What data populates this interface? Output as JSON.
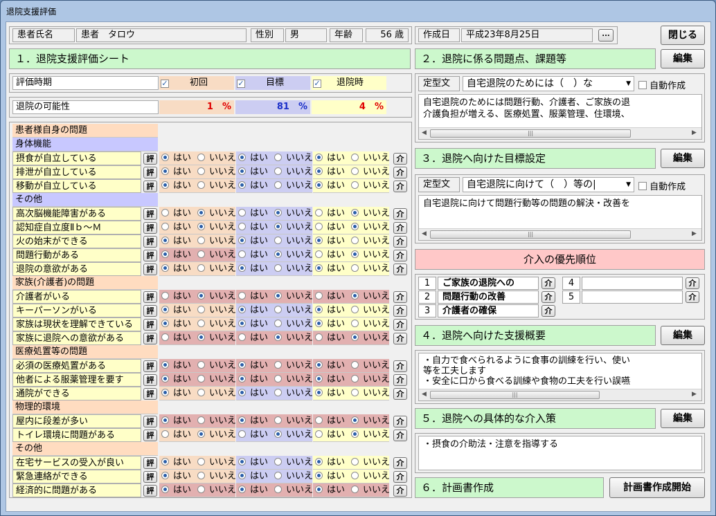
{
  "window": {
    "title": "退院支援評価"
  },
  "patient": {
    "name_label": "患者氏名",
    "name": "患者　タロウ",
    "sex_label": "性別",
    "sex": "男",
    "age_label": "年齢",
    "age": "56 歳"
  },
  "header": {
    "date_label": "作成日",
    "date": "平成23年8月25日",
    "dots_label": "...",
    "close_label": "閉じる"
  },
  "sheet": {
    "title": "１．退院支援評価シート",
    "eval_label": "評価時期",
    "col1": "初回",
    "col2": "目標",
    "col3": "退院時",
    "possibility_label": "退院の可能性",
    "p1": "1",
    "p2": "81",
    "p3": "4",
    "pct": "%"
  },
  "labels": {
    "yes": "はい",
    "no": "いいえ",
    "eval_btn": "評",
    "int_btn": "介"
  },
  "items": [
    {
      "type": "header",
      "style": "hdrO",
      "label": "患者様自身の問題"
    },
    {
      "type": "header",
      "style": "hdrB",
      "label": "身体機能"
    },
    {
      "type": "item",
      "label": "摂食が自立している",
      "vals": [
        1,
        1,
        1
      ],
      "reds": [
        0,
        0,
        0
      ]
    },
    {
      "type": "item",
      "label": "排泄が自立している",
      "vals": [
        1,
        1,
        1
      ],
      "reds": [
        0,
        0,
        0
      ]
    },
    {
      "type": "item",
      "label": "移動が自立している",
      "vals": [
        1,
        1,
        1
      ],
      "reds": [
        0,
        0,
        0
      ]
    },
    {
      "type": "header",
      "style": "hdrB",
      "label": "その他"
    },
    {
      "type": "item",
      "label": "高次脳機能障害がある",
      "vals": [
        0,
        0,
        0
      ],
      "reds": [
        0,
        0,
        0
      ]
    },
    {
      "type": "item",
      "label": "認知症自立度Ⅱｂ～Ｍ",
      "vals": [
        0,
        0,
        0
      ],
      "reds": [
        0,
        0,
        0
      ]
    },
    {
      "type": "item",
      "label": "火の始末ができる",
      "vals": [
        1,
        1,
        1
      ],
      "reds": [
        0,
        0,
        0
      ]
    },
    {
      "type": "item",
      "label": "問題行動がある",
      "vals": [
        1,
        0,
        0
      ],
      "reds": [
        1,
        0,
        0
      ]
    },
    {
      "type": "item",
      "label": "退院の意欲がある",
      "vals": [
        1,
        1,
        1
      ],
      "reds": [
        0,
        0,
        0
      ]
    },
    {
      "type": "header",
      "style": "hdrO",
      "label": "家族(介護者)の問題"
    },
    {
      "type": "item",
      "label": "介護者がいる",
      "vals": [
        0,
        0,
        0
      ],
      "reds": [
        1,
        1,
        1
      ]
    },
    {
      "type": "item",
      "label": "キーパーソンがいる",
      "vals": [
        1,
        1,
        1
      ],
      "reds": [
        0,
        0,
        0
      ]
    },
    {
      "type": "item",
      "label": "家族は現状を理解できている",
      "vals": [
        1,
        1,
        1
      ],
      "reds": [
        0,
        0,
        0
      ]
    },
    {
      "type": "item",
      "label": "家族に退院への意欲がある",
      "vals": [
        0,
        0,
        0
      ],
      "reds": [
        1,
        1,
        1
      ]
    },
    {
      "type": "header",
      "style": "hdrO",
      "label": "医療処置等の問題"
    },
    {
      "type": "item",
      "label": "必須の医療処置がある",
      "vals": [
        1,
        1,
        1
      ],
      "reds": [
        1,
        1,
        1
      ]
    },
    {
      "type": "item",
      "label": "他者による服薬管理を要す",
      "vals": [
        1,
        1,
        1
      ],
      "reds": [
        1,
        1,
        1
      ]
    },
    {
      "type": "item",
      "label": "通院ができる",
      "vals": [
        1,
        1,
        1
      ],
      "reds": [
        0,
        0,
        0
      ]
    },
    {
      "type": "header",
      "style": "hdrO",
      "label": "物理的環境"
    },
    {
      "type": "item",
      "label": "屋内に段差が多い",
      "vals": [
        1,
        1,
        0
      ],
      "reds": [
        1,
        1,
        1
      ]
    },
    {
      "type": "item",
      "label": "トイレ環境に問題がある",
      "vals": [
        0,
        0,
        0
      ],
      "reds": [
        0,
        0,
        0
      ]
    },
    {
      "type": "header",
      "style": "hdrO",
      "label": "その他"
    },
    {
      "type": "item",
      "label": "在宅サービスの受入が良い",
      "vals": [
        1,
        1,
        1
      ],
      "reds": [
        0,
        0,
        0
      ]
    },
    {
      "type": "item",
      "label": "緊急連絡ができる",
      "vals": [
        1,
        1,
        1
      ],
      "reds": [
        0,
        0,
        0
      ]
    },
    {
      "type": "item",
      "label": "経済的に問題がある",
      "vals": [
        1,
        1,
        1
      ],
      "reds": [
        1,
        1,
        1
      ]
    }
  ],
  "section2": {
    "title": "２．退院に係る問題点、課題等",
    "edit_label": "編集",
    "template_label": "定型文",
    "template_value": "自宅退院のためには（　）な",
    "auto_label": "自動作成",
    "text_line1": "自宅退院のためには問題行動、介護者、ご家族の退",
    "text_line2": "介護負担が増える、医療処置、服薬管理、住環境、"
  },
  "section3": {
    "title": "３．退院へ向けた目標設定",
    "edit_label": "編集",
    "template_label": "定型文",
    "template_value": "自宅退院に向けて（　）等の|",
    "auto_label": "自動作成",
    "text_line1": "自宅退院に向けて問題行動等の問題の解決・改善を"
  },
  "priority": {
    "title": "介入の優先順位",
    "rows": [
      {
        "num": "1",
        "text": "ご家族の退院への"
      },
      {
        "num": "2",
        "text": "問題行動の改善"
      },
      {
        "num": "3",
        "text": "介護者の確保"
      },
      {
        "num": "4",
        "text": ""
      },
      {
        "num": "5",
        "text": ""
      }
    ]
  },
  "section4": {
    "title": "４．退院へ向けた支援概要",
    "edit_label": "編集",
    "text_line1": "・自力で食べられるように食事の訓練を行い、使い",
    "text_line2": "等を工夫します",
    "text_line3": "・安全に口から食べる訓練や食物の工夫を行い誤嚥"
  },
  "section5": {
    "title": "５．退院への具体的な介入策",
    "edit_label": "編集",
    "text_line1": "・摂食の介助法・注意を指導する"
  },
  "section6": {
    "title": "６．計画書作成",
    "start_label": "計画書作成開始"
  },
  "colors": {
    "peach": "#f8dcc4",
    "lavender": "#cccdf2",
    "red": "#e2b0b0",
    "yellow": "#ffffc8",
    "green": "#ccf8cc",
    "pink": "#ffc8c8"
  }
}
